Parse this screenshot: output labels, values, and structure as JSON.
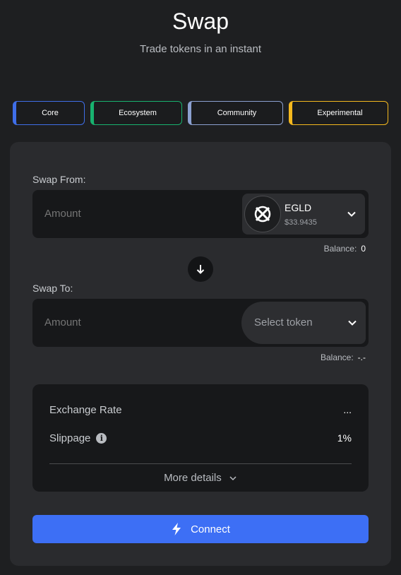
{
  "header": {
    "title": "Swap",
    "subtitle": "Trade tokens in an instant"
  },
  "tabs": [
    {
      "label": "Core",
      "color": "#3f6ee8"
    },
    {
      "label": "Ecosystem",
      "color": "#18b26f"
    },
    {
      "label": "Community",
      "color": "#8ba0d0"
    },
    {
      "label": "Experimental",
      "color": "#f4b81e"
    }
  ],
  "swap_from": {
    "label": "Swap From:",
    "amount_placeholder": "Amount",
    "token": {
      "symbol": "EGLD",
      "price": "$33.9435",
      "icon": "egld-logo-icon"
    },
    "balance_label": "Balance:",
    "balance_value": "0"
  },
  "swap_to": {
    "label": "Swap To:",
    "amount_placeholder": "Amount",
    "select_placeholder": "Select token",
    "balance_label": "Balance:",
    "balance_value": "-.-"
  },
  "details": {
    "exchange_rate_label": "Exchange Rate",
    "exchange_rate_value": "...",
    "slippage_label": "Slippage",
    "slippage_value": "1%",
    "more_label": "More details"
  },
  "connect": {
    "label": "Connect",
    "color": "#3d6ff5"
  }
}
